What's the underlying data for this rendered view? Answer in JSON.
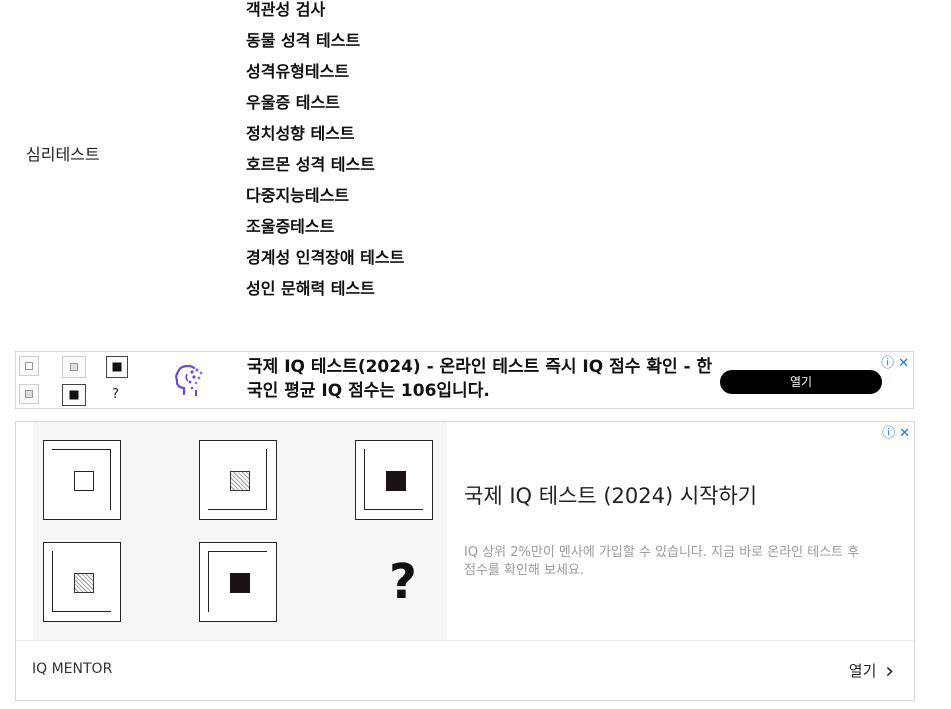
{
  "category": {
    "label": "심리테스트"
  },
  "tests": [
    "객관성 검사",
    "동물 성격 테스트",
    "성격유형테스트",
    "우울증 테스트",
    "정치성향 테스트",
    "호르몬 성격 테스트",
    "다중지능테스트",
    "조울증테스트",
    "경계성 인격장애 테스트",
    "성인 문해력 테스트"
  ],
  "banner_ad": {
    "title": "국제 IQ 테스트(2024) - 온라인 테스트 즉시 IQ 점수 확인 - 한국인 평균 IQ 점수는 106입니다.",
    "open_label": "열기",
    "question_mark": "?",
    "adchoice_icon": "info-icon",
    "close_icon": "close-icon",
    "accent": "#000000"
  },
  "big_ad": {
    "headline": "국제 IQ 테스트 (2024) 시작하기",
    "description": "IQ 상위 2%만이 멘사에 가입할 수 있습니다. 지금 바로 온라인 테스트 후 점수를 확인해 보세요.",
    "advertiser": "IQ MENTOR",
    "open_label": "열기",
    "open_chevron": "›",
    "question_mark": "?",
    "adchoice_color": "#1a73e8"
  }
}
